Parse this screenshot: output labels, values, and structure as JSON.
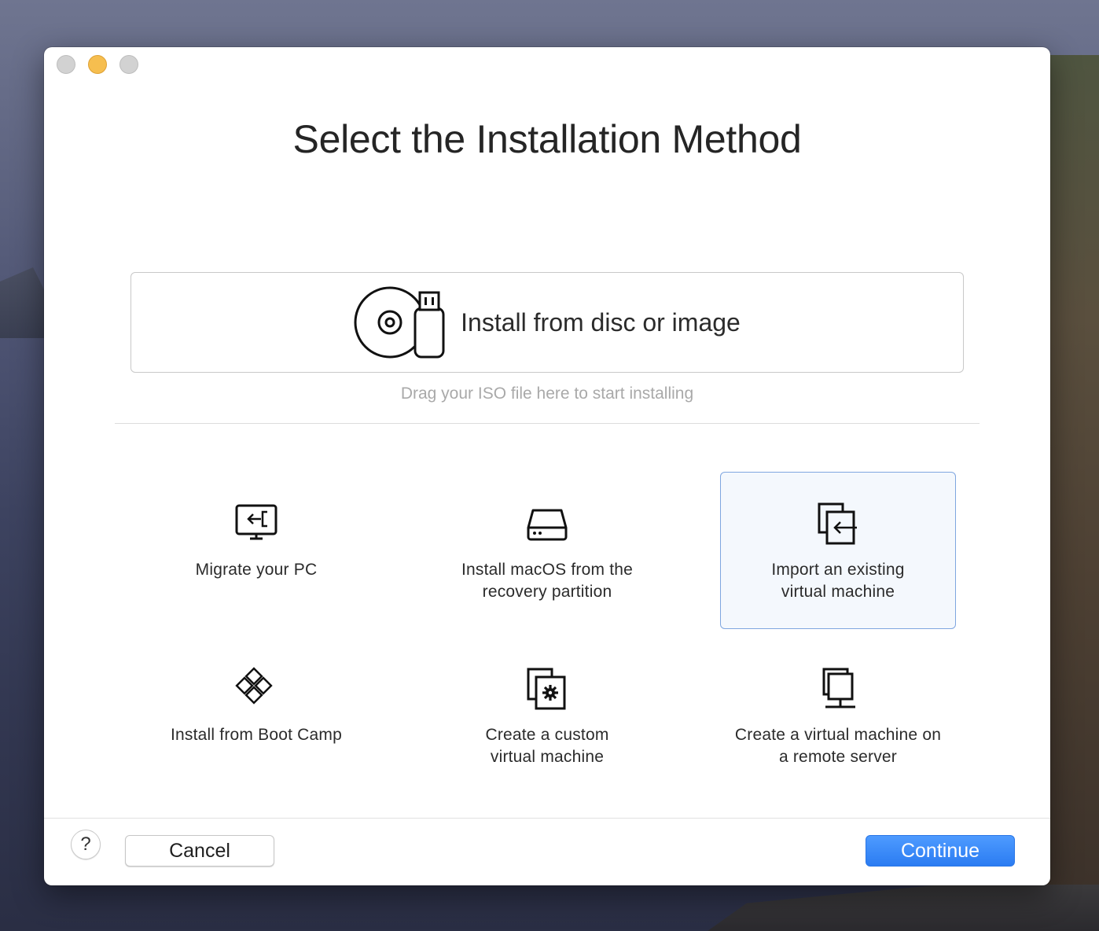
{
  "window": {
    "title": "Select the Installation Method"
  },
  "disc_option": {
    "label": "Install from disc or image",
    "icon": "disc-usb-icon",
    "hint": "Drag your ISO file here to start installing"
  },
  "options": [
    {
      "label": "Migrate your PC",
      "icon": "monitor-import-icon",
      "selected": false
    },
    {
      "label": "Install macOS from the\nrecovery partition",
      "icon": "hard-drive-icon",
      "selected": false
    },
    {
      "label": "Import an existing\nvirtual machine",
      "icon": "import-vm-icon",
      "selected": true
    },
    {
      "label": "Install from Boot Camp",
      "icon": "bootcamp-icon",
      "selected": false
    },
    {
      "label": "Create a custom\nvirtual machine",
      "icon": "custom-vm-gear-icon",
      "selected": false
    },
    {
      "label": "Create a virtual machine on\na remote server",
      "icon": "remote-server-icon",
      "selected": false
    }
  ],
  "footer": {
    "help_label": "?",
    "cancel_label": "Cancel",
    "continue_label": "Continue"
  },
  "colors": {
    "accent": "#2b7cf2",
    "selection_border": "#7fa6e0",
    "selection_fill": "#f4f8fd"
  }
}
